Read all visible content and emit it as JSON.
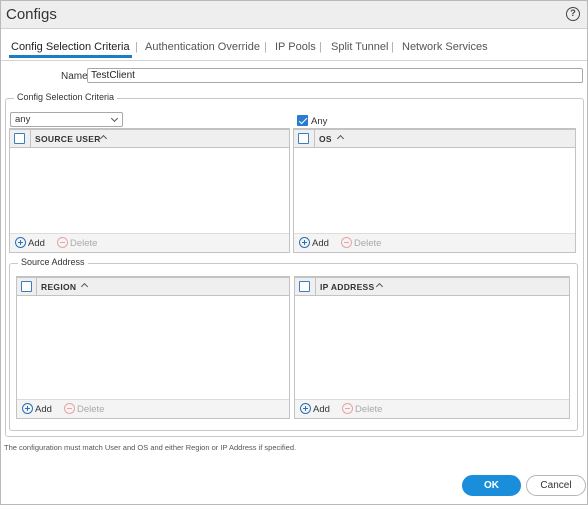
{
  "dialog": {
    "title": "Configs",
    "help_icon": "?"
  },
  "tabs": [
    {
      "label": "Config Selection Criteria",
      "active": true
    },
    {
      "label": "Authentication Override",
      "active": false
    },
    {
      "label": "IP Pools",
      "active": false
    },
    {
      "label": "Split Tunnel",
      "active": false
    },
    {
      "label": "Network Services",
      "active": false
    }
  ],
  "tab_separator": "|",
  "name_field": {
    "label": "Name",
    "value": "TestClient"
  },
  "criteria_group": {
    "legend": "Config Selection Criteria",
    "user_select": {
      "value": "any"
    },
    "os_any": {
      "label": "Any",
      "checked": true
    },
    "source_user_panel": {
      "column": "SOURCE USER",
      "add": "Add",
      "delete": "Delete"
    },
    "os_panel": {
      "column": "OS",
      "add": "Add",
      "delete": "Delete"
    }
  },
  "source_address_group": {
    "legend": "Source Address",
    "region_panel": {
      "column": "REGION",
      "add": "Add",
      "delete": "Delete"
    },
    "ip_panel": {
      "column": "IP ADDRESS",
      "add": "Add",
      "delete": "Delete"
    }
  },
  "note": "The configuration must match User and OS and either Region or IP Address if specified.",
  "buttons": {
    "ok": "OK",
    "cancel": "Cancel"
  },
  "colors": {
    "accent": "#1b8edb",
    "tab_underline": "#1b7ec2",
    "delete_disabled": "#aaaaaa"
  },
  "icons": [
    "help-icon",
    "checkbox-icon",
    "sort-ascending-icon",
    "add-circle-icon",
    "delete-circle-icon",
    "chevron-down-icon"
  ]
}
